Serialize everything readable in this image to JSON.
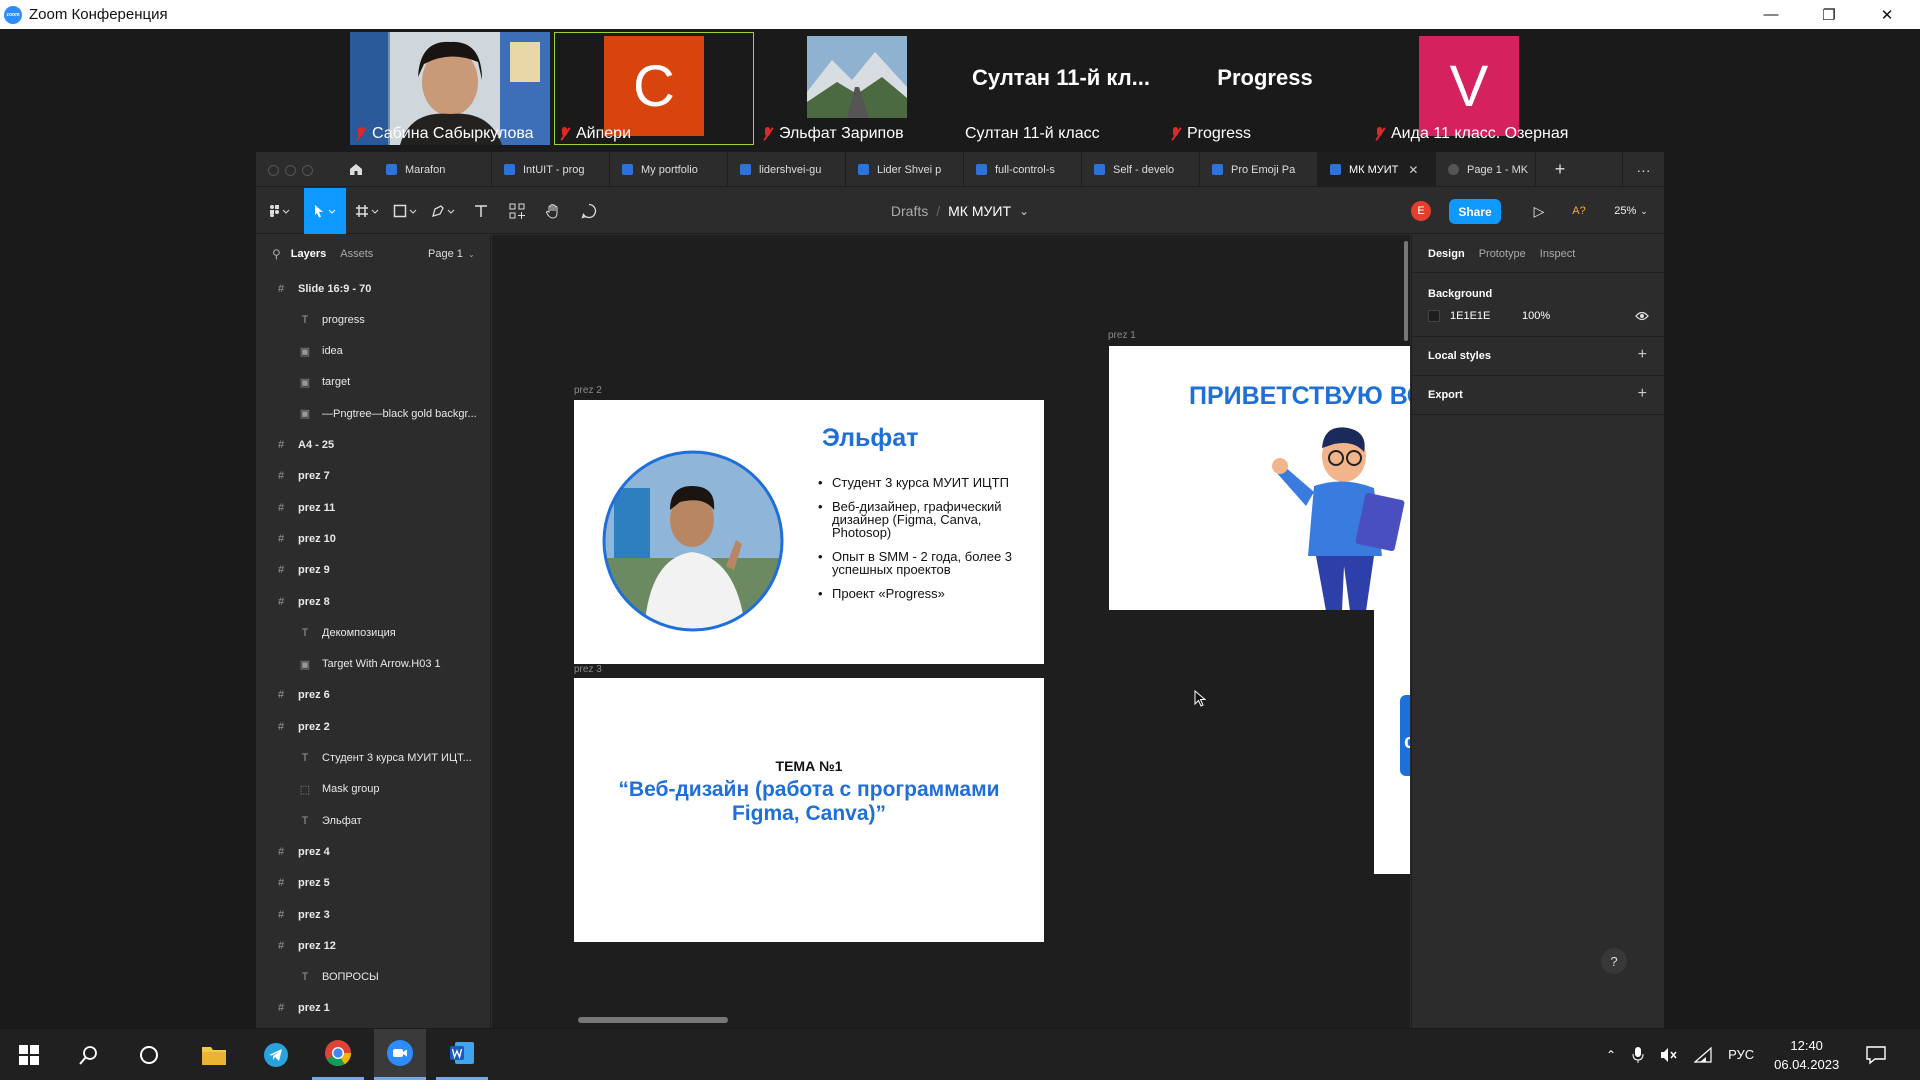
{
  "window": {
    "title": "Zoom Конференция",
    "controls": {
      "minimize": "—",
      "restore": "❐",
      "close": "✕"
    }
  },
  "participants": [
    {
      "name": "Сабина Сабыркулова",
      "type": "video",
      "muted": true
    },
    {
      "name": "Айпери",
      "type": "avatar",
      "initial": "С",
      "color": "#d9430e",
      "muted": true,
      "active_speaker": true
    },
    {
      "name": "Эльфат Зарипов",
      "type": "image",
      "muted": true
    },
    {
      "name": "Султан 11-й класс",
      "type": "name",
      "display": "Султан 11-й кл...",
      "muted": false
    },
    {
      "name": "Progress",
      "type": "name",
      "display": "Progress",
      "muted": true
    },
    {
      "name": "Аида 11 класс. Озерная",
      "type": "avatar",
      "initial": "V",
      "color": "#d6215f",
      "muted": true
    }
  ],
  "figma": {
    "tabs": [
      {
        "label": "Marafon"
      },
      {
        "label": "IntUIT - prog"
      },
      {
        "label": "My portfolio"
      },
      {
        "label": "lidershvei-gu"
      },
      {
        "label": "Lider Shvei p"
      },
      {
        "label": "full-control-s"
      },
      {
        "label": "Self - develo"
      },
      {
        "label": "Pro Emoji Pa"
      },
      {
        "label": "МК МУИТ",
        "active": true,
        "close": "✕"
      },
      {
        "label": "Page 1 - MK"
      }
    ],
    "new_tab": "+",
    "more": "···",
    "breadcrumb": {
      "drafts": "Drafts",
      "sep": "/",
      "file": "МК МУИТ",
      "chevron": "⌄"
    },
    "user_initial": "E",
    "share_label": "Share",
    "present_icon": "▷",
    "fonts_label": "A?",
    "zoom": "25%",
    "layers_panel": {
      "tabs": [
        "Layers",
        "Assets"
      ],
      "page": "Page 1",
      "items": [
        {
          "label": "Slide 16:9 - 70",
          "kind": "frame"
        },
        {
          "label": "progress",
          "kind": "text"
        },
        {
          "label": "idea",
          "kind": "image"
        },
        {
          "label": "target",
          "kind": "image"
        },
        {
          "label": "—Pngtree—black gold backgr...",
          "kind": "image"
        },
        {
          "label": "A4 - 25",
          "kind": "frame"
        },
        {
          "label": "prez 7",
          "kind": "frame"
        },
        {
          "label": "prez 11",
          "kind": "frame"
        },
        {
          "label": "prez 10",
          "kind": "frame"
        },
        {
          "label": "prez 9",
          "kind": "frame"
        },
        {
          "label": "prez 8",
          "kind": "frame"
        },
        {
          "label": "Декомпозиция",
          "kind": "text"
        },
        {
          "label": "Target With Arrow.H03 1",
          "kind": "image"
        },
        {
          "label": "prez 6",
          "kind": "frame"
        },
        {
          "label": "prez 2",
          "kind": "frame"
        },
        {
          "label": "Студент 3 курса МУИТ ИЦТ...",
          "kind": "text"
        },
        {
          "label": "Mask group",
          "kind": "mask"
        },
        {
          "label": "Эльфат",
          "kind": "text"
        },
        {
          "label": "prez 4",
          "kind": "frame"
        },
        {
          "label": "prez 5",
          "kind": "frame"
        },
        {
          "label": "prez 3",
          "kind": "frame"
        },
        {
          "label": "prez 12",
          "kind": "frame"
        },
        {
          "label": "ВОПРОСЫ",
          "kind": "text"
        },
        {
          "label": "prez 1",
          "kind": "frame"
        }
      ]
    },
    "canvas": {
      "frame_labels": {
        "prez1": "prez 1",
        "prez2": "prez 2",
        "prez3": "prez 3"
      },
      "prez2": {
        "name": "Эльфат",
        "bullets": [
          "Студент 3 курса МУИТ ИЦТП",
          "Веб-дизайнер, графический дизайнер (Figma, Canva, Photosop)",
          "Опыт в SMM - 2 года, более 3 успешных проектов",
          "Проект «Progress»"
        ]
      },
      "prez1": {
        "heading": "ПРИВЕТСТВУЮ ВСЕХ",
        "button_text": "стест"
      },
      "prez3": {
        "topic_label": "ТЕМА №1",
        "topic_title": "“Веб-дизайн (работа с программами Figma, Canva)”"
      }
    },
    "design_panel": {
      "tabs": [
        "Design",
        "Prototype",
        "Inspect"
      ],
      "background_title": "Background",
      "background_hex": "1E1E1E",
      "background_opacity": "100%",
      "local_styles": "Local styles",
      "export": "Export",
      "help": "?"
    }
  },
  "taskbar": {
    "language": "РУС",
    "time": "12:40",
    "date": "06.04.2023"
  },
  "colors": {
    "accent": "#0d99ff",
    "slide_blue": "#1f6fd8",
    "zoom_blue": "#2d8cff"
  }
}
